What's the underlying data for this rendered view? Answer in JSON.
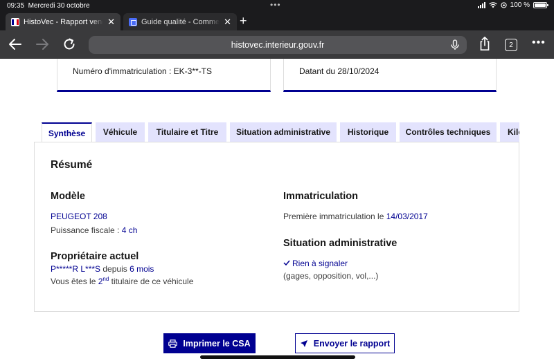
{
  "status": {
    "time": "09:35",
    "date": "Mercredi 30 octobre",
    "battery": "100 %"
  },
  "browser": {
    "tabs": [
      {
        "title": "HistoVec - Rapport vendeur"
      },
      {
        "title": "Guide qualité - Commentaires"
      }
    ],
    "url": "histovec.interieur.gouv.fr",
    "tab_count": "2"
  },
  "cards": {
    "left": "Numéro d'immatriculation : EK-3**-TS",
    "right": "Datant du 28/10/2024"
  },
  "report_tabs": [
    {
      "label": "Synthèse"
    },
    {
      "label": "Véhicule"
    },
    {
      "label": "Titulaire et Titre"
    },
    {
      "label": "Situation administrative"
    },
    {
      "label": "Historique"
    },
    {
      "label": "Contrôles techniques"
    },
    {
      "label": "Kilométrage"
    }
  ],
  "summary": {
    "title": "Résumé",
    "model": {
      "heading": "Modèle",
      "name": "PEUGEOT 208",
      "power_label": "Puissance fiscale : ",
      "power_value": "4 ch"
    },
    "owner": {
      "heading": "Propriétaire actuel",
      "name": "P*****R L***S",
      "since_label": " depuis ",
      "since_value": "6 mois",
      "rank_prefix": "Vous êtes le ",
      "rank_number": "2",
      "rank_suffix": "nd",
      "rank_rest": " titulaire de ce véhicule"
    },
    "registration": {
      "heading": "Immatriculation",
      "first_label": "Première immatriculation le ",
      "first_date": "14/03/2017"
    },
    "admin": {
      "heading": "Situation administrative",
      "status": "Rien à signaler",
      "details": "(gages, opposition, vol,...)"
    }
  },
  "actions": {
    "print": "Imprimer le CSA",
    "send": "Envoyer le rapport"
  }
}
